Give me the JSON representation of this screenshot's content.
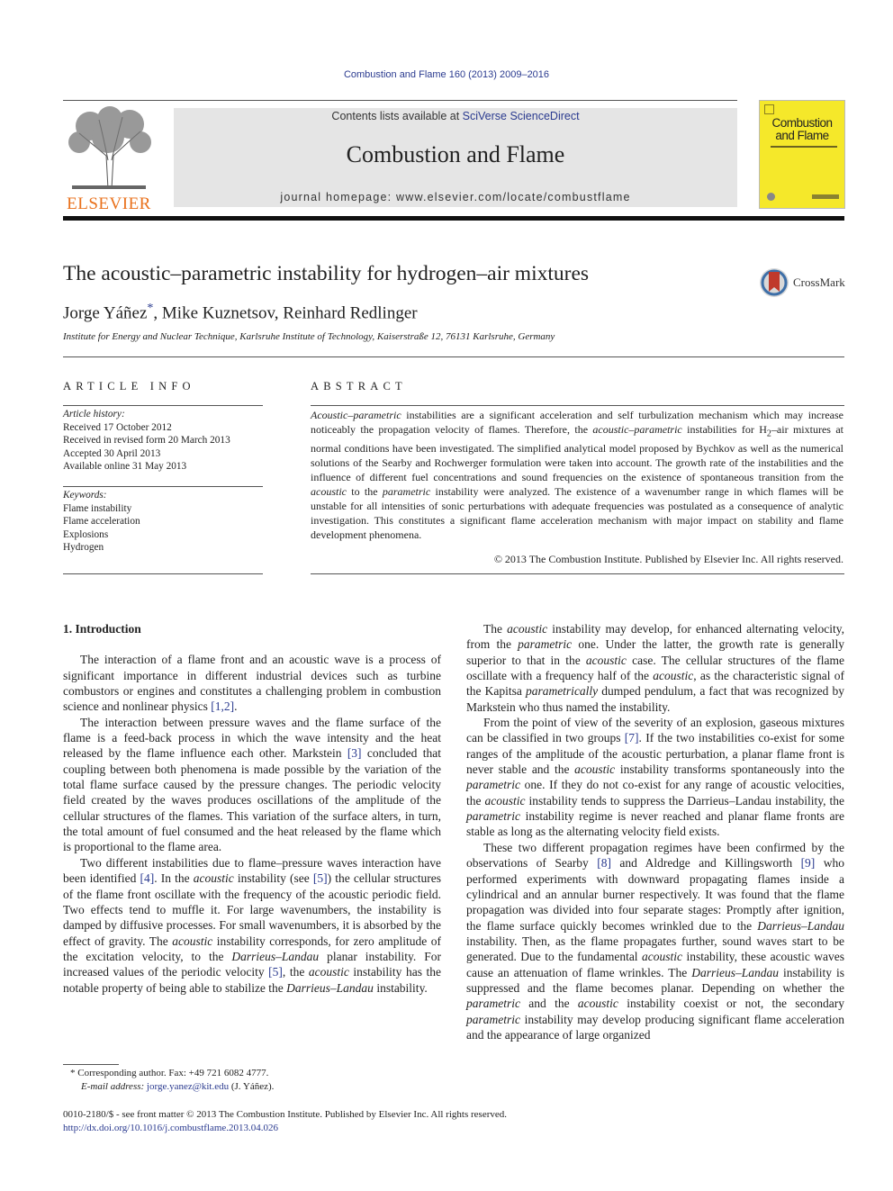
{
  "journal_citation": "Combustion and Flame 160 (2013) 2009–2016",
  "masthead": {
    "contents_prefix": "Contents lists available at ",
    "contents_link": "SciVerse ScienceDirect",
    "journal_title": "Combustion and Flame",
    "homepage_prefix": "journal homepage: ",
    "homepage_url": "www.elsevier.com/locate/combustflame",
    "publisher_logo_text": "ELSEVIER",
    "cover_title_line1": "Combustion",
    "cover_title_line2": "and Flame"
  },
  "colors": {
    "link": "#2a3a8f",
    "cover_yellow": "#f5e82a",
    "elsevier_orange": "#e9711c",
    "crossmark_red": "#c0392b"
  },
  "article": {
    "title": "The acoustic–parametric instability for hydrogen–air mixtures",
    "crossmark_label": "CrossMark",
    "authors": [
      {
        "name": "Jorge Yáñez",
        "marker": "*"
      },
      {
        "name": "Mike Kuznetsov"
      },
      {
        "name": "Reinhard Redlinger"
      }
    ],
    "affiliation": "Institute for Energy and Nuclear Technique, Karlsruhe Institute of Technology, Kaiserstraße 12, 76131 Karlsruhe, Germany"
  },
  "article_info": {
    "heading": "ARTICLE INFO",
    "history_label": "Article history:",
    "history": [
      "Received 17 October 2012",
      "Received in revised form 20 March 2013",
      "Accepted 30 April 2013",
      "Available online 31 May 2013"
    ],
    "keywords_label": "Keywords:",
    "keywords": [
      "Flame instability",
      "Flame acceleration",
      "Explosions",
      "Hydrogen"
    ]
  },
  "abstract": {
    "heading": "ABSTRACT",
    "segments": [
      {
        "t": "Acoustic–parametric",
        "i": true
      },
      {
        "t": " instabilities are a significant acceleration and self turbulization mechanism which may increase noticeably the propagation velocity of flames. Therefore, the "
      },
      {
        "t": "acoustic–parametric",
        "i": true
      },
      {
        "t": " instabilities for H"
      },
      {
        "t": "2",
        "sub": true
      },
      {
        "t": "–air mixtures at normal conditions have been investigated. The simplified analytical model proposed by Bychkov as well as the numerical solutions of the Searby and Rochwerger formulation were taken into account. The growth rate of the instabilities and the influence of different fuel concentrations and sound frequencies on the existence of spontaneous transition from the "
      },
      {
        "t": "acoustic",
        "i": true
      },
      {
        "t": " to the "
      },
      {
        "t": "parametric",
        "i": true
      },
      {
        "t": " instability were analyzed. The existence of a wavenumber range in which flames will be unstable for all intensities of sonic perturbations with adequate frequencies was postulated as a consequence of analytic investigation. This constitutes a significant flame acceleration mechanism with major impact on stability and flame development phenomena."
      }
    ],
    "copyright": "© 2013 The Combustion Institute. Published by Elsevier Inc. All rights reserved."
  },
  "body": {
    "section_heading": "1. Introduction",
    "left_paragraphs": [
      [
        {
          "t": "The interaction of a flame front and an acoustic wave is a process of significant importance in different industrial devices such as turbine combustors or engines and constitutes a challenging problem in combustion science and nonlinear physics "
        },
        {
          "t": "[1,2]",
          "link": true
        },
        {
          "t": "."
        }
      ],
      [
        {
          "t": "The interaction between pressure waves and the flame surface of the flame is a feed-back process in which the wave intensity and the heat released by the flame influence each other. Markstein "
        },
        {
          "t": "[3]",
          "link": true
        },
        {
          "t": " concluded that coupling between both phenomena is made possible by the variation of the total flame surface caused by the pressure changes. The periodic velocity field created by the waves produces oscillations of the amplitude of the cellular structures of the flames. This variation of the surface alters, in turn, the total amount of fuel consumed and the heat released by the flame which is proportional to the flame area."
        }
      ],
      [
        {
          "t": "Two different instabilities due to flame–pressure waves interaction have been identified "
        },
        {
          "t": "[4]",
          "link": true
        },
        {
          "t": ". In the "
        },
        {
          "t": "acoustic",
          "i": true
        },
        {
          "t": " instability (see "
        },
        {
          "t": "[5]",
          "link": true
        },
        {
          "t": ") the cellular structures of the flame front oscillate with the frequency of the acoustic periodic field. Two effects tend to muffle it. For large wavenumbers, the instability is damped by diffusive processes. For small wavenumbers, it is absorbed by the effect of gravity. The "
        },
        {
          "t": "acoustic",
          "i": true
        },
        {
          "t": " instability corresponds, for zero amplitude of the excitation velocity, to the "
        },
        {
          "t": "Darrieus–Landau",
          "i": true
        },
        {
          "t": " planar instability. For increased values of the periodic velocity "
        },
        {
          "t": "[5]",
          "link": true
        },
        {
          "t": ", the "
        },
        {
          "t": "acoustic",
          "i": true
        },
        {
          "t": " instability has the notable property of being able to stabilize the "
        },
        {
          "t": "Darrieus–Landau",
          "i": true
        },
        {
          "t": " instability."
        }
      ]
    ],
    "right_paragraphs": [
      [
        {
          "t": "The "
        },
        {
          "t": "acoustic",
          "i": true
        },
        {
          "t": " instability may develop, for enhanced alternating velocity, from the "
        },
        {
          "t": "parametric",
          "i": true
        },
        {
          "t": " one. Under the latter, the growth rate is generally superior to that in the "
        },
        {
          "t": "acoustic",
          "i": true
        },
        {
          "t": " case. The cellular structures of the flame oscillate with a frequency half of the "
        },
        {
          "t": "acoustic",
          "i": true
        },
        {
          "t": ", as the characteristic signal of the Kapitsa "
        },
        {
          "t": "parametrically",
          "i": true
        },
        {
          "t": " dumped pendulum, a fact that was recognized by Markstein who thus named the instability."
        }
      ],
      [
        {
          "t": "From the point of view of the severity of an explosion, gaseous mixtures can be classified in two groups "
        },
        {
          "t": "[7]",
          "link": true
        },
        {
          "t": ". If the two instabilities co-exist for some ranges of the amplitude of the acoustic perturbation, a planar flame front is never stable and the "
        },
        {
          "t": "acoustic",
          "i": true
        },
        {
          "t": " instability transforms spontaneously into the "
        },
        {
          "t": "parametric",
          "i": true
        },
        {
          "t": " one. If they do not co-exist for any range of acoustic velocities, the "
        },
        {
          "t": "acoustic",
          "i": true
        },
        {
          "t": " instability tends to suppress the Darrieus–Landau instability, the "
        },
        {
          "t": "parametric",
          "i": true
        },
        {
          "t": " instability regime is never reached and planar flame fronts are stable as long as the alternating velocity field exists."
        }
      ],
      [
        {
          "t": "These two different propagation regimes have been confirmed by the observations of Searby "
        },
        {
          "t": "[8]",
          "link": true
        },
        {
          "t": " and Aldredge and Killingsworth "
        },
        {
          "t": "[9]",
          "link": true
        },
        {
          "t": " who performed experiments with downward propagating flames inside a cylindrical and an annular burner respectively. It was found that the flame propagation was divided into four separate stages: Promptly after ignition, the flame surface quickly becomes wrinkled due to the "
        },
        {
          "t": "Darrieus–Landau",
          "i": true
        },
        {
          "t": " instability. Then, as the flame propagates further, sound waves start to be generated. Due to the fundamental "
        },
        {
          "t": "acoustic",
          "i": true
        },
        {
          "t": " instability, these acoustic waves cause an attenuation of flame wrinkles. The "
        },
        {
          "t": "Darrieus–Landau",
          "i": true
        },
        {
          "t": " instability is suppressed and the flame becomes planar. Depending on whether the "
        },
        {
          "t": "parametric",
          "i": true
        },
        {
          "t": " and the "
        },
        {
          "t": "acoustic",
          "i": true
        },
        {
          "t": " instability coexist or not, the secondary "
        },
        {
          "t": "parametric",
          "i": true
        },
        {
          "t": " instability may develop producing significant flame acceleration and the appearance of large organized"
        }
      ]
    ]
  },
  "footnote": {
    "marker": "*",
    "corresponding": "Corresponding author. Fax: +49 721 6082 4777.",
    "email_label": "E-mail address: ",
    "email": "jorge.yanez@kit.edu",
    "email_suffix": " (J. Yáñez)."
  },
  "front_matter": {
    "issn_line": "0010-2180/$ - see front matter © 2013 The Combustion Institute. Published by Elsevier Inc. All rights reserved.",
    "doi": "http://dx.doi.org/10.1016/j.combustflame.2013.04.026"
  }
}
